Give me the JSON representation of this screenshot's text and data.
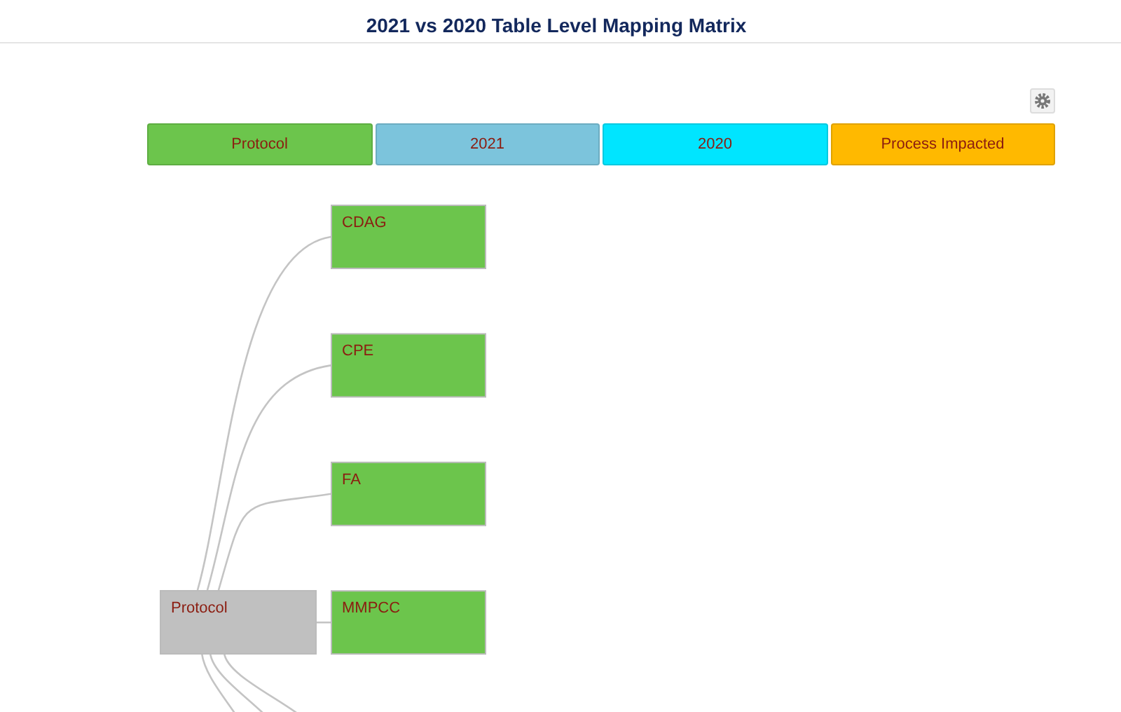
{
  "title": "2021 vs 2020 Table Level Mapping Matrix",
  "columns": [
    {
      "label": "Protocol",
      "color": "#6cc54c"
    },
    {
      "label": "2021",
      "color": "#7cc4dc"
    },
    {
      "label": "2020",
      "color": "#00e5ff"
    },
    {
      "label": "Process Impacted",
      "color": "#ffb900"
    }
  ],
  "tree": {
    "label": "Protocol",
    "children": [
      {
        "label": "CDAG"
      },
      {
        "label": "CPE"
      },
      {
        "label": "FA"
      },
      {
        "label": "MMPCC"
      }
    ]
  }
}
